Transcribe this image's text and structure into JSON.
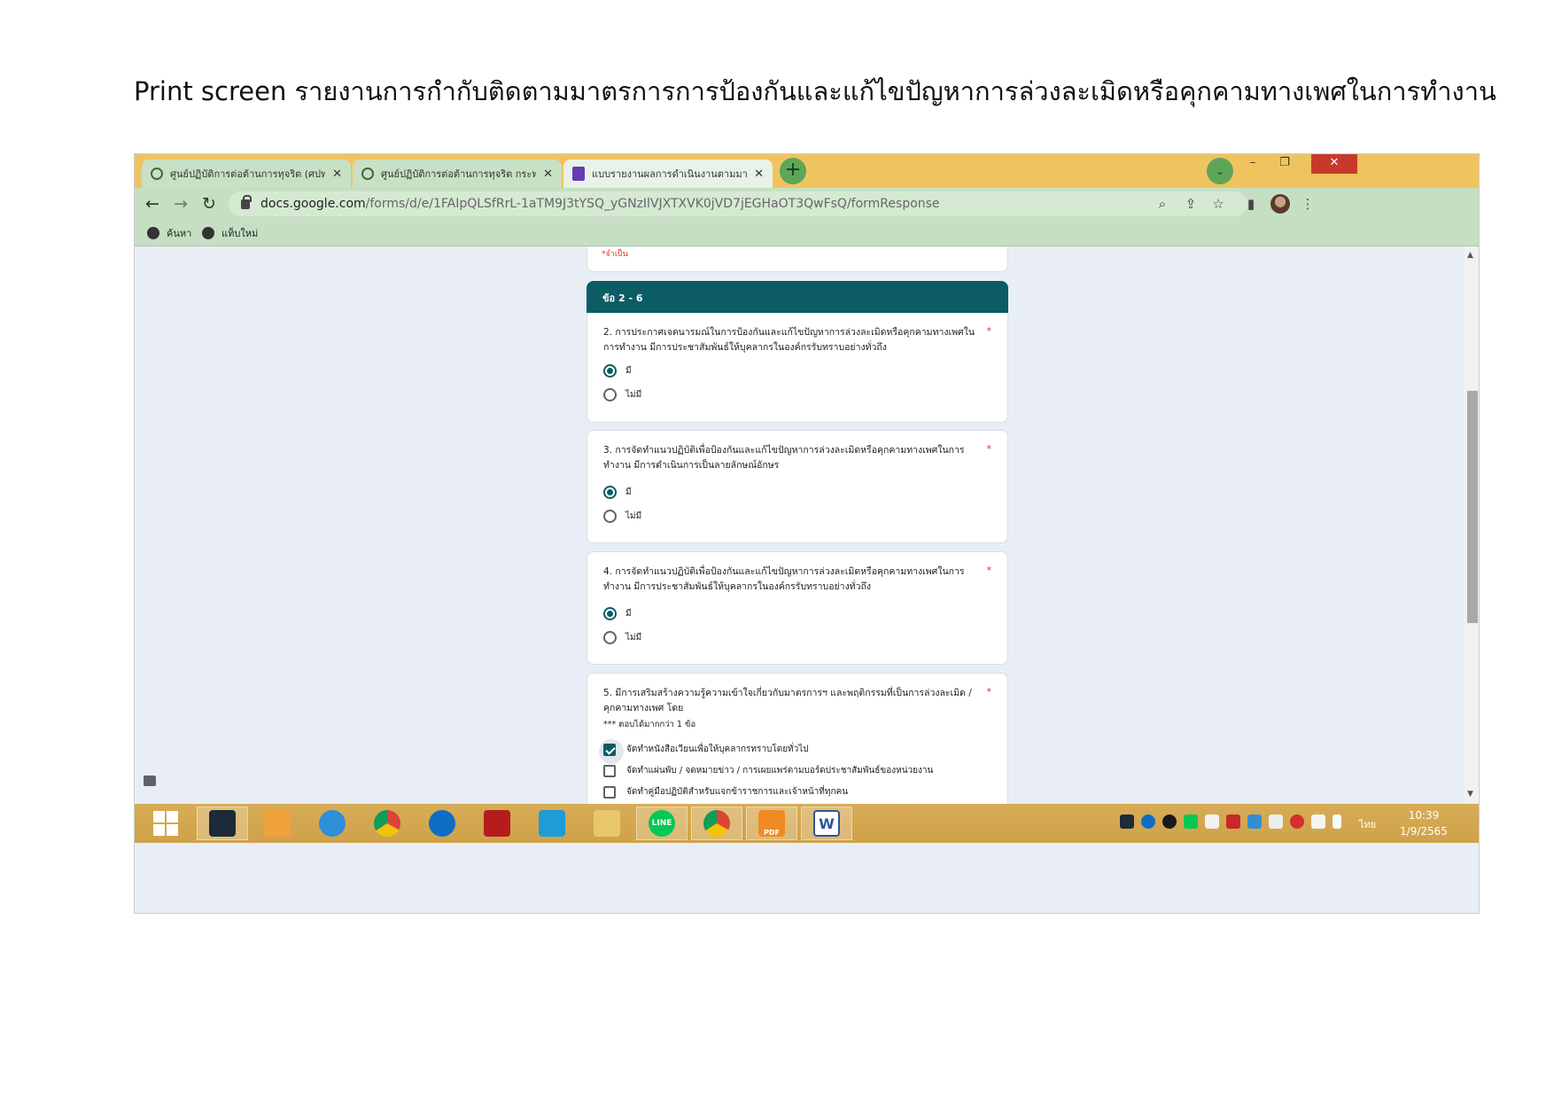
{
  "document": {
    "heading": "Print screen รายงานการกำกับติดตามมาตรการการป้องกันและแก้ไขปัญหาการล่วงละเมิดหรือคุกคามทางเพศในการทำงาน"
  },
  "browser": {
    "tabs": [
      {
        "title": "ศูนย์ปฏิบัติการต่อต้านการทุจริต (ศปท.)",
        "icon": "green-shield-icon",
        "active": false
      },
      {
        "title": "ศูนย์ปฏิบัติการต่อต้านการทุจริต กระทรวง",
        "icon": "green-shield-icon",
        "active": false
      },
      {
        "title": "แบบรายงานผลการดำเนินงานตามมาตรการ",
        "icon": "google-forms-icon",
        "active": true
      }
    ],
    "new_tab_symbol": "+",
    "tab_search_symbol": "⌄",
    "window_controls": {
      "minimize": "–",
      "restore": "❐",
      "close": "✕"
    },
    "url_domain": "docs.google.com",
    "url_path": "/forms/d/e/1FAIpQLSfRrL-1aTM9J3tYSQ_yGNzIlVJXTXVK0jVD7jEGHaOT3QwFsQ/formResponse",
    "bookmarks": [
      "ค้นหา",
      "แท็บใหม่"
    ]
  },
  "form": {
    "required_note": "*จำเป็น",
    "section_title": "ข้อ 2 - 6",
    "questions": [
      {
        "title": "2. การประกาศเจตนารมณ์ในการป้องกันและแก้ไขปัญหาการล่วงละเมิดหรือคุกคามทางเพศในการทำงาน มีการประชาสัมพันธ์ให้บุคลากรในองค์กรรับทราบอย่างทั่วถึง",
        "options": [
          "มี",
          "ไม่มี"
        ],
        "selected": "มี"
      },
      {
        "title": "3. การจัดทำแนวปฏิบัติเพื่อป้องกันและแก้ไขปัญหาการล่วงละเมิดหรือคุกคามทางเพศในการทำงาน มีการดำเนินการเป็นลายลักษณ์อักษร",
        "options": [
          "มี",
          "ไม่มี"
        ],
        "selected": "มี"
      },
      {
        "title": "4. การจัดทำแนวปฏิบัติเพื่อป้องกันและแก้ไขปัญหาการล่วงละเมิดหรือคุกคามทางเพศในการทำงาน มีการประชาสัมพันธ์ให้บุคลากรในองค์กรรับทราบอย่างทั่วถึง",
        "options": [
          "มี",
          "ไม่มี"
        ],
        "selected": "มี"
      },
      {
        "title": "5. มีการเสริมสร้างความรู้ความเข้าใจเกี่ยวกับมาตรการฯ และพฤติกรรมที่เป็นการล่วงละเมิด / คุกคามทางเพศ โดย",
        "hint": "*** ตอบได้มากกว่า 1 ข้อ",
        "checkboxes": [
          {
            "label": "จัดทำหนังสือเวียนเพื่อให้บุคลากรทราบโดยทั่วไป",
            "checked": true
          },
          {
            "label": "จัดทำแผ่นพับ / จดหมายข่าว / การเผยแพร่ตามบอร์ดประชาสัมพันธ์ของหน่วยงาน",
            "checked": false
          },
          {
            "label": "จัดทำคู่มือปฏิบัติสำหรับแจกข้าราชการและเจ้าหน้าที่ทุกคน",
            "checked": false
          }
        ]
      }
    ],
    "required_star": "*"
  },
  "taskbar": {
    "apps": [
      "start-button",
      "webex",
      "media-player",
      "internet-explorer",
      "chrome",
      "teamviewer",
      "file-shredder",
      "file-transfer",
      "file-explorer",
      "line",
      "chrome-profile",
      "pdf-tool",
      "word"
    ],
    "app_labels": {
      "line": "LINE",
      "word": "W",
      "pdf": "PDF"
    },
    "language": "ไทย",
    "time": "10:39",
    "date": "1/9/2565"
  }
}
